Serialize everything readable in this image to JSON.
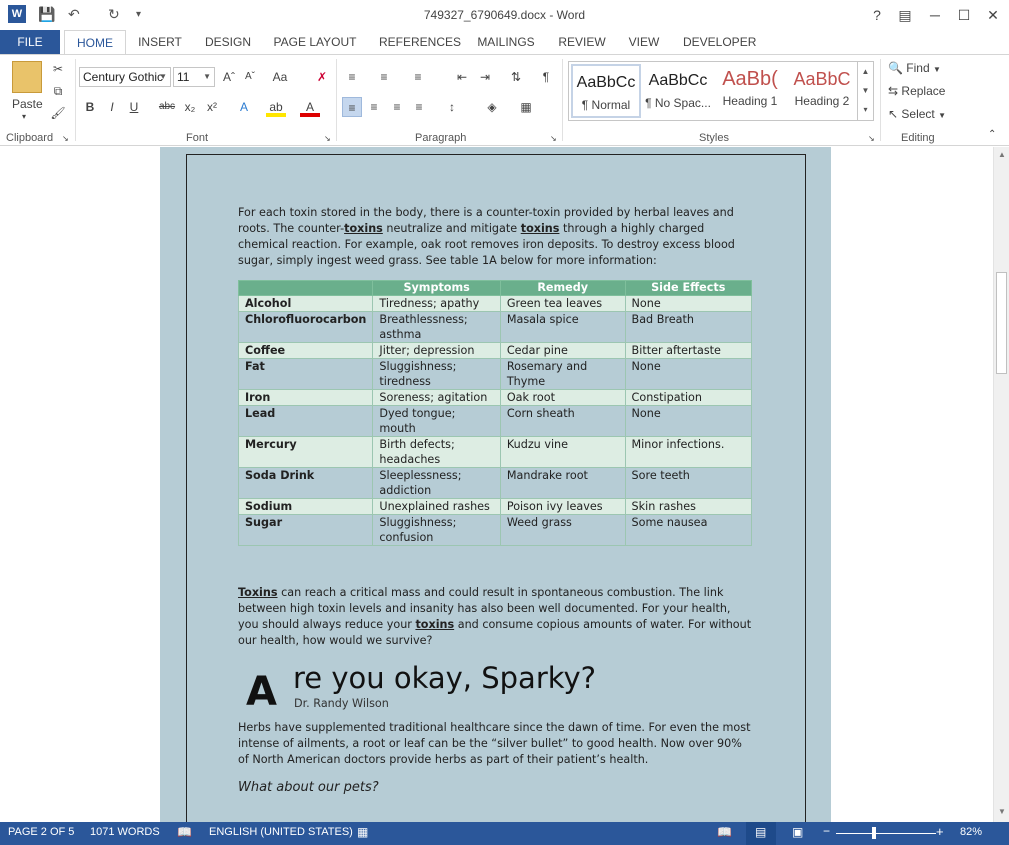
{
  "window": {
    "title": "749327_6790649.docx - Word",
    "help": "?",
    "minimize": "─",
    "maximize": "☐",
    "close": "✕"
  },
  "tabs": [
    "FILE",
    "HOME",
    "INSERT",
    "DESIGN",
    "PAGE LAYOUT",
    "REFERENCES",
    "MAILINGS",
    "REVIEW",
    "VIEW",
    "DEVELOPER"
  ],
  "ribbon": {
    "clipboard": {
      "label": "Clipboard",
      "paste": "Paste"
    },
    "font": {
      "label": "Font",
      "family": "Century Gothic",
      "size": "11"
    },
    "paragraph": {
      "label": "Paragraph"
    },
    "styles": {
      "label": "Styles",
      "items": [
        {
          "sample": "AaBbCc",
          "name": "¶ Normal"
        },
        {
          "sample": "AaBbCc",
          "name": "¶ No Spac..."
        },
        {
          "sample": "AaBb(",
          "name": "Heading 1"
        },
        {
          "sample": "AaBbC",
          "name": "Heading 2"
        }
      ]
    },
    "editing": {
      "label": "Editing",
      "find": "Find",
      "replace": "Replace",
      "select": "Select"
    }
  },
  "document": {
    "intro_p1": "For each toxin stored in the body, there is a counter-toxin provided by herbal leaves and roots. The counter-",
    "intro_w1": "toxins",
    "intro_p2": " neutralize and mitigate ",
    "intro_w2": "toxins",
    "intro_p3": " through a highly charged chemical reaction. For example, oak root removes iron deposits. To destroy excess blood sugar, simply ingest weed grass.  See table 1A below for more information:",
    "table": {
      "headers": [
        "",
        "Symptoms",
        "Remedy",
        "Side Effects"
      ],
      "rows": [
        [
          "Alcohol",
          "Tiredness; apathy",
          "Green tea leaves",
          "None"
        ],
        [
          "Chlorofluorocarbon",
          "Breathlessness; asthma",
          "Masala spice",
          "Bad Breath"
        ],
        [
          "Coffee",
          "Jitter; depression",
          "Cedar pine",
          "Bitter aftertaste"
        ],
        [
          "Fat",
          "Sluggishness; tiredness",
          "Rosemary and Thyme",
          "None"
        ],
        [
          "Iron",
          "Soreness; agitation",
          "Oak root",
          "Constipation"
        ],
        [
          "Lead",
          "Dyed tongue; mouth",
          "Corn sheath",
          "None"
        ],
        [
          "Mercury",
          "Birth defects; headaches",
          "Kudzu vine",
          "Minor infections."
        ],
        [
          "Soda Drink",
          "Sleeplessness; addiction",
          "Mandrake root",
          "Sore teeth"
        ],
        [
          "Sodium",
          "Unexplained rashes",
          "Poison ivy leaves",
          "Skin rashes"
        ],
        [
          "Sugar",
          "Sluggishness; confusion",
          "Weed grass",
          "Some nausea"
        ]
      ]
    },
    "body_w1": "Toxins",
    "body_p1": " can reach a critical mass and could result in spontaneous combustion. The link between high toxin levels and insanity has also been well documented.  For your health, you should always reduce your ",
    "body_w2": "toxins",
    "body_p2": " and consume copious amounts of water. For without our health, how would we survive?",
    "heading_dropcap": "A",
    "heading_rest": "re you okay, Sparky?",
    "author": "Dr. Randy Wilson",
    "herbs": "Herbs have supplemented traditional healthcare since the dawn of time. For even the most intense of ailments, a root or leaf can be the “silver bullet” to good health. Now over 90% of North American doctors provide herbs as part of their patient’s health.",
    "pets": "What about our pets?"
  },
  "status": {
    "page": "PAGE 2 OF 5",
    "words": "1071 WORDS",
    "language": "ENGLISH (UNITED STATES)",
    "zoom": "82%"
  },
  "colors": {
    "accent": "#2b579a",
    "page": "#b6ccd5",
    "table_header": "#6aaf8c"
  }
}
